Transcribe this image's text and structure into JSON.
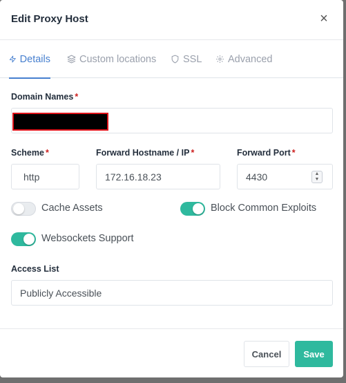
{
  "dialog": {
    "title": "Edit Proxy Host",
    "close_glyph": "×"
  },
  "tabs": [
    {
      "label": "Details",
      "icon": "lightning-icon",
      "active": true
    },
    {
      "label": "Custom locations",
      "icon": "layers-icon",
      "active": false
    },
    {
      "label": "SSL",
      "icon": "shield-icon",
      "active": false
    },
    {
      "label": "Advanced",
      "icon": "gear-icon",
      "active": false
    }
  ],
  "form": {
    "domain_names": {
      "label": "Domain Names",
      "required": "*"
    },
    "scheme": {
      "label": "Scheme",
      "required": "*",
      "value": "http"
    },
    "forward_hostname": {
      "label": "Forward Hostname / IP",
      "required": "*",
      "value": "172.16.18.23"
    },
    "forward_port": {
      "label": "Forward Port",
      "required": "*",
      "value": "4430"
    },
    "toggles": {
      "cache_assets": {
        "label": "Cache Assets",
        "on": false
      },
      "block_exploits": {
        "label": "Block Common Exploits",
        "on": true
      },
      "websockets": {
        "label": "Websockets Support",
        "on": true
      }
    },
    "access_list": {
      "label": "Access List",
      "value": "Publicly Accessible"
    }
  },
  "footer": {
    "cancel_label": "Cancel",
    "save_label": "Save"
  },
  "colors": {
    "accent": "#467fcf",
    "toggle_on": "#2fb99e",
    "required": "#cd201f",
    "redaction_border": "#e0141b"
  }
}
